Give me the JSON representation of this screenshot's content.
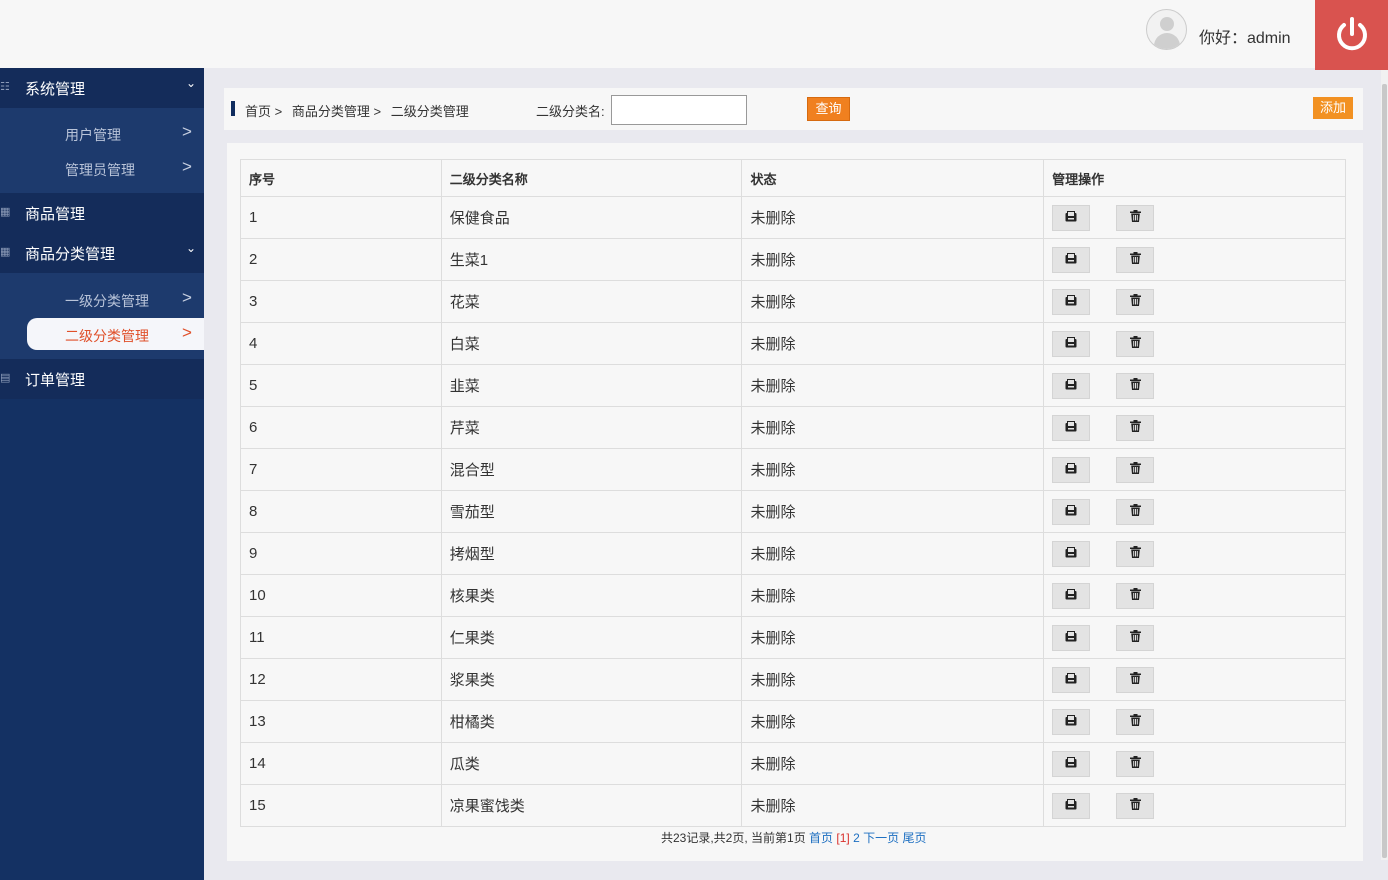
{
  "header": {
    "greeting": "你好：admin"
  },
  "sidebar": {
    "groups": [
      {
        "label": "系统管理",
        "items": [
          {
            "label": "用户管理"
          },
          {
            "label": "管理员管理"
          }
        ]
      },
      {
        "label": "商品管理"
      },
      {
        "label": "商品分类管理",
        "items": [
          {
            "label": "一级分类管理"
          },
          {
            "label": "二级分类管理"
          }
        ]
      },
      {
        "label": "订单管理"
      }
    ],
    "active_item": "二级分类管理",
    "arrow_glyph": ">"
  },
  "toolbar": {
    "breadcrumb": [
      "首页 >",
      "商品分类管理 >",
      "二级分类管理"
    ],
    "search_label": "二级分类名:",
    "search_value": "",
    "query_label": "查询",
    "add_label": "添加"
  },
  "table": {
    "headers": [
      "序号",
      "二级分类名称",
      "状态",
      "管理操作"
    ],
    "rows": [
      {
        "id": "1",
        "name": "保健食品",
        "status": "未删除"
      },
      {
        "id": "2",
        "name": "生菜1",
        "status": "未删除"
      },
      {
        "id": "3",
        "name": "花菜",
        "status": "未删除"
      },
      {
        "id": "4",
        "name": "白菜",
        "status": "未删除"
      },
      {
        "id": "5",
        "name": "韭菜",
        "status": "未删除"
      },
      {
        "id": "6",
        "name": "芹菜",
        "status": "未删除"
      },
      {
        "id": "7",
        "name": "混合型",
        "status": "未删除"
      },
      {
        "id": "8",
        "name": "雪茄型",
        "status": "未删除"
      },
      {
        "id": "9",
        "name": "拷烟型",
        "status": "未删除"
      },
      {
        "id": "10",
        "name": "核果类",
        "status": "未删除"
      },
      {
        "id": "11",
        "name": "仁果类",
        "status": "未删除"
      },
      {
        "id": "12",
        "name": "浆果类",
        "status": "未删除"
      },
      {
        "id": "13",
        "name": "柑橘类",
        "status": "未删除"
      },
      {
        "id": "14",
        "name": "瓜类",
        "status": "未删除"
      },
      {
        "id": "15",
        "name": "凉果蜜饯类",
        "status": "未删除"
      }
    ]
  },
  "pager": {
    "summary": "共23记录,共2页, 当前第1页",
    "first": "首页",
    "current": "[1]",
    "page2": "2",
    "next": "下一页",
    "last": "尾页"
  },
  "colors": {
    "sidebar": "#143163",
    "accent": "#f29122",
    "logout": "#d9534f",
    "active_text": "#e0502a"
  }
}
